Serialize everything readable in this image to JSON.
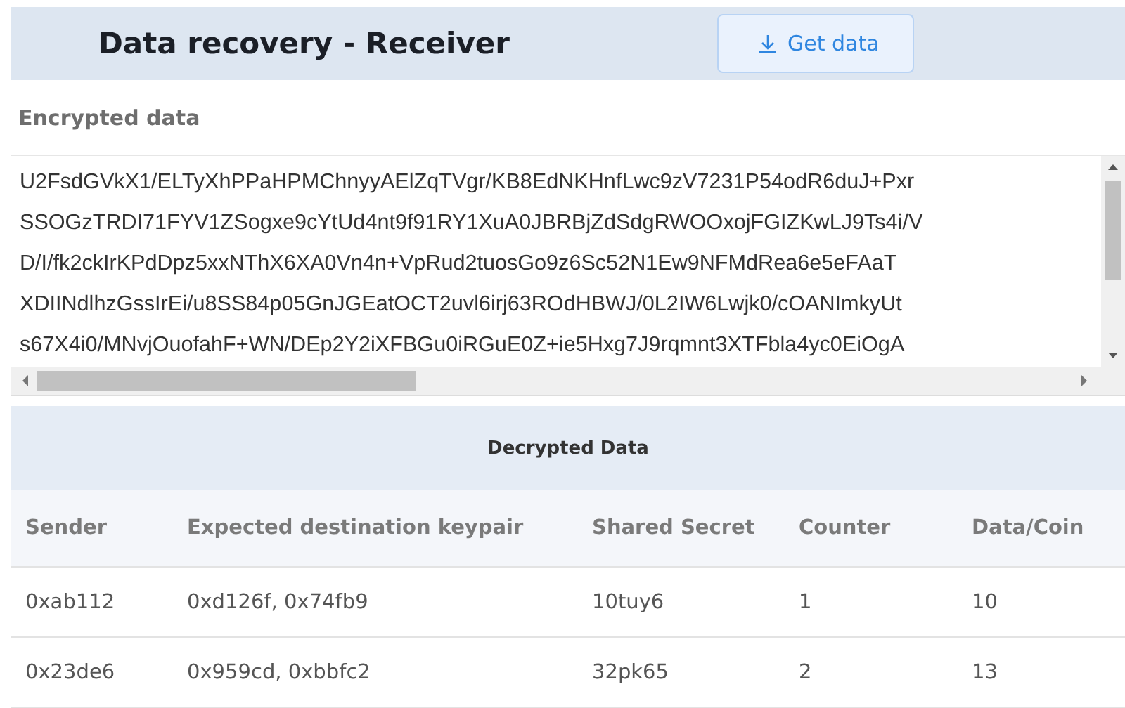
{
  "header": {
    "title": "Data recovery - Receiver",
    "button": "Get data"
  },
  "encrypted": {
    "label": "Encrypted data",
    "lines": [
      "U2FsdGVkX1/ELTyXhPPaHPMChnyyAElZqTVgr/KB8EdNKHnfLwc9zV7231P54odR6duJ+Pxr",
      "SSOGzTRDI71FYV1ZSogxe9cYtUd4nt9f91RY1XuA0JBRBjZdSdgRWOOxojFGIZKwLJ9Ts4i/V",
      "D/I/fk2ckIrKPdDpz5xxNThX6XA0Vn4n+VpRud2tuosGo9z6Sc52N1Ew9NFMdRea6e5eFAaT",
      "XDIINdlhzGssIrEi/u8SS84p05GnJGEatOCT2uvl6irj63ROdHBWJ/0L2IW6Lwjk0/cOANImkyUt",
      "s67X4i0/MNvjOuofahF+WN/DEp2Y2iXFBGu0iRGuE0Z+ie5Hxg7J9rqmnt3XTFbla4yc0EiOgA"
    ]
  },
  "decrypted": {
    "title": "Decrypted Data",
    "columns": [
      "Sender",
      "Expected destination keypair",
      "Shared Secret",
      "Counter",
      "Data/Coin"
    ],
    "rows": [
      [
        "0xab112",
        "0xd126f, 0x74fb9",
        "10tuy6",
        "1",
        "10"
      ],
      [
        "0x23de6",
        "0x959cd, 0xbbfc2",
        "32pk65",
        "2",
        "13"
      ]
    ]
  }
}
